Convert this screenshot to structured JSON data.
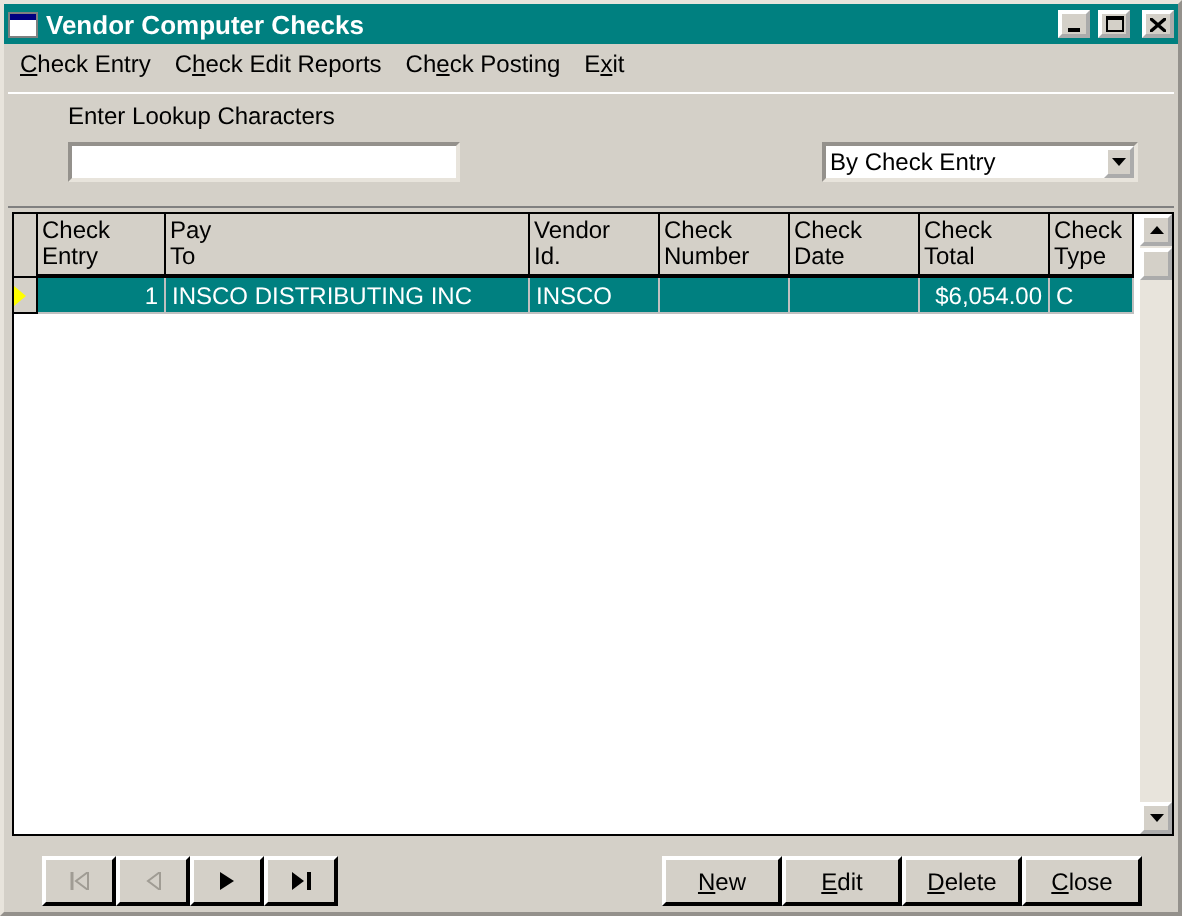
{
  "window": {
    "title": "Vendor Computer Checks"
  },
  "menu": [
    {
      "label": "Check Entry"
    },
    {
      "label": "Check Edit Reports"
    },
    {
      "label": "Check Posting"
    },
    {
      "label": "Exit"
    }
  ],
  "lookup": {
    "label": "Enter Lookup Characters",
    "sort": "By Check Entry"
  },
  "table": {
    "columns": [
      {
        "label": "Check Entry"
      },
      {
        "label": "Pay To"
      },
      {
        "label": "Vendor Id."
      },
      {
        "label": "Check Number"
      },
      {
        "label": "Check Date"
      },
      {
        "label": "Check Total"
      },
      {
        "label": "Check Type"
      }
    ],
    "rows": [
      {
        "selected": true,
        "cells": [
          "1",
          "INSCO DISTRIBUTING INC",
          "INSCO",
          "",
          "",
          "$6,054.00",
          "C"
        ]
      }
    ]
  },
  "navigation": [
    {
      "kind": "first",
      "disabled": true
    },
    {
      "kind": "prev",
      "disabled": true
    },
    {
      "kind": "next",
      "disabled": false
    },
    {
      "kind": "last",
      "disabled": false
    }
  ],
  "buttons": [
    {
      "label": "New"
    },
    {
      "label": "Edit"
    },
    {
      "label": "Delete"
    },
    {
      "label": "Close"
    }
  ]
}
